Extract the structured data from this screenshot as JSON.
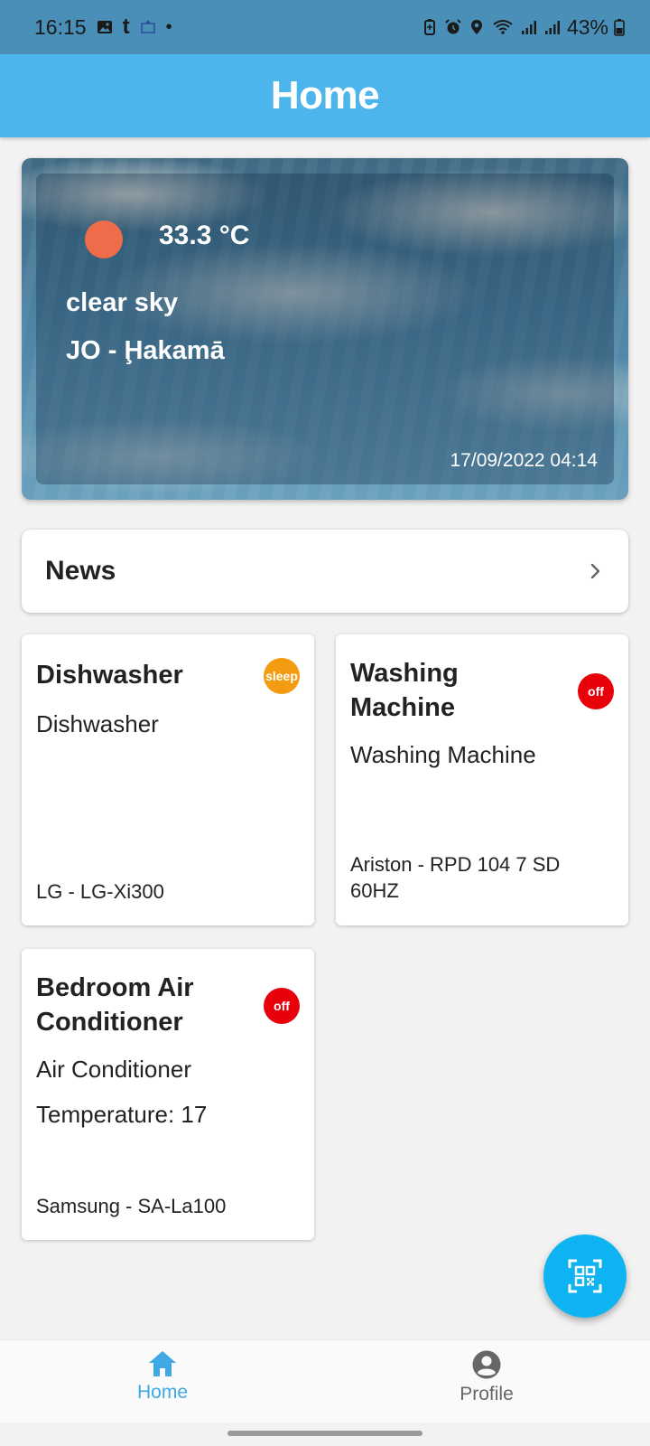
{
  "status_bar": {
    "time": "16:15",
    "battery": "43%",
    "left_icons": [
      "image-icon",
      "tumblr-icon",
      "app-notification-icon",
      "dot-icon"
    ],
    "right_icons": [
      "battery-saver-icon",
      "alarm-icon",
      "location-icon",
      "wifi-icon",
      "signal-icon",
      "signal-icon",
      "battery-icon"
    ]
  },
  "app_bar": {
    "title": "Home"
  },
  "weather": {
    "temperature": "33.3 °C",
    "description": "clear sky",
    "location": "JO - Ḩakamā",
    "datetime": "17/09/2022 04:14",
    "sun_color": "#ef6c4a"
  },
  "news": {
    "title": "News"
  },
  "devices": [
    {
      "name": "Dishwasher",
      "type": "Dishwasher",
      "extra": "",
      "model": "LG - LG-Xi300",
      "status": "sleep",
      "status_color": "#f39c12"
    },
    {
      "name": "Washing Machine",
      "type": "Washing Machine",
      "extra": "",
      "model": "Ariston - RPD 104 7 SD 60HZ",
      "status": "off",
      "status_color": "#e8000b"
    },
    {
      "name": "Bedroom Air Conditioner",
      "type": "Air Conditioner",
      "extra": "Temperature: 17",
      "model": "Samsung - SA-La100",
      "status": "off",
      "status_color": "#e8000b"
    }
  ],
  "fab": {
    "icon": "qr-code-icon"
  },
  "bottom_nav": {
    "items": [
      {
        "label": "Home",
        "icon": "home-icon",
        "active": true
      },
      {
        "label": "Profile",
        "icon": "profile-icon",
        "active": false
      }
    ]
  },
  "colors": {
    "accent": "#4cb6ec",
    "status_bar": "#4a8fb7",
    "fab": "#0eb3f2",
    "nav_active": "#3ea9e4",
    "nav_inactive": "#666666"
  }
}
